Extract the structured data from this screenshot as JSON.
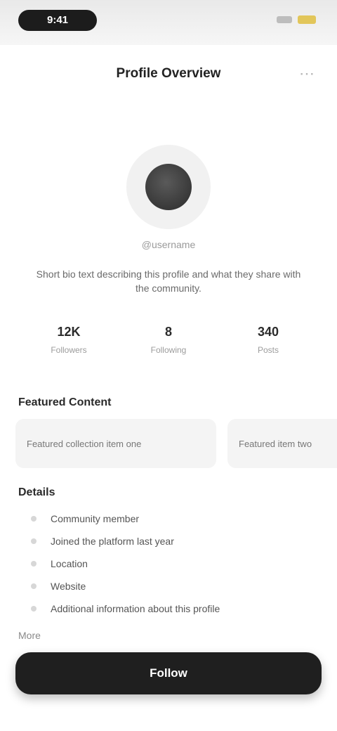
{
  "status_bar": {
    "time": "9:41"
  },
  "header": {
    "title": "Profile Overview"
  },
  "profile": {
    "name": "@username",
    "bio": "Short bio text describing this profile and what they share with the community."
  },
  "stats": [
    {
      "value": "12K",
      "label": "Followers"
    },
    {
      "value": "8",
      "label": "Following"
    },
    {
      "value": "340",
      "label": "Posts"
    }
  ],
  "sections": {
    "featured": {
      "title": "Featured Content",
      "cards": [
        "Featured collection item one",
        "Featured item two"
      ]
    },
    "details": {
      "title": "Details",
      "items": [
        "Community member",
        "Joined the platform last year",
        "Location",
        "Website",
        "Additional information about this profile"
      ]
    },
    "more": {
      "title": "More"
    }
  },
  "cta": {
    "label": "Follow"
  },
  "icons": {
    "more": "more-icon"
  }
}
